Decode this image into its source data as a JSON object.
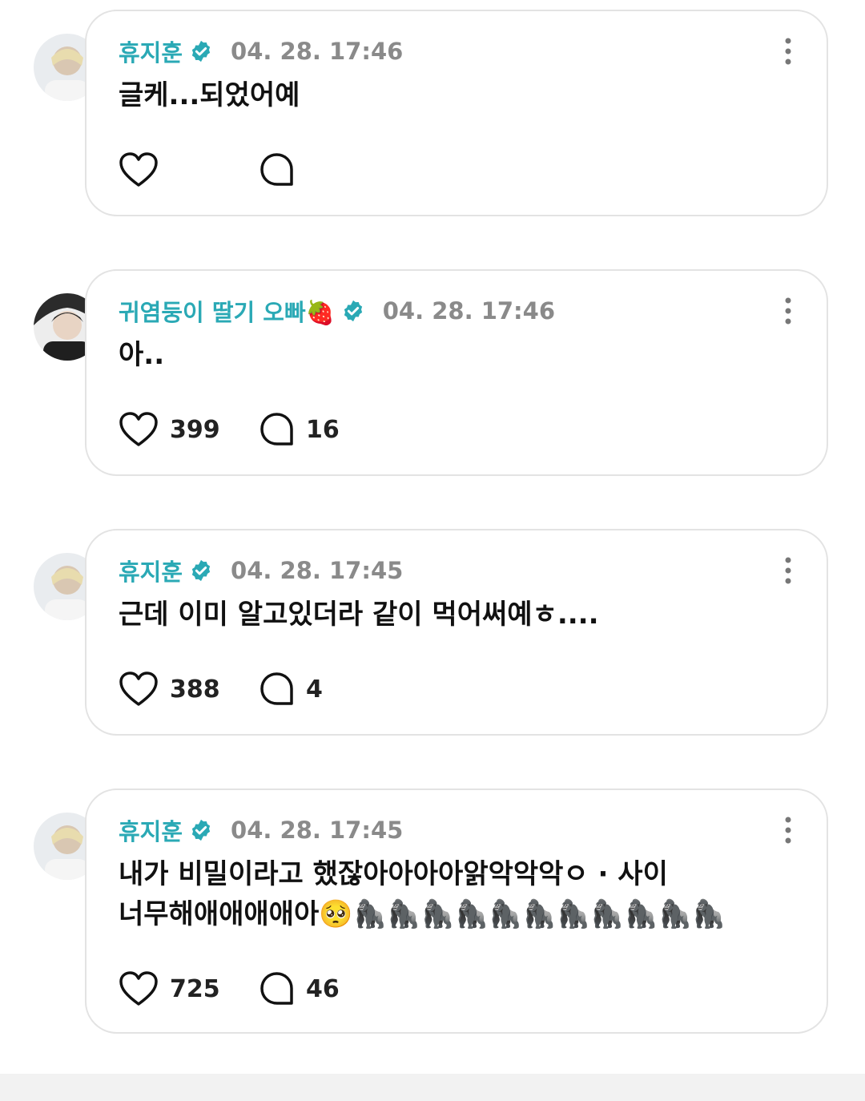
{
  "posts": [
    {
      "author": "휴지훈",
      "time": "04. 28. 17:46",
      "text": "글케...되었어예",
      "likes": "",
      "replies": ""
    },
    {
      "author": "귀염둥이 딸기 오빠🍓",
      "time": "04. 28. 17:46",
      "text": "아..",
      "likes": "399",
      "replies": "16"
    },
    {
      "author": "휴지훈",
      "time": "04. 28. 17:45",
      "text": "근데 이미 알고있더라 같이 먹어써예ㅎ....",
      "likes": "388",
      "replies": "4"
    },
    {
      "author": "휴지훈",
      "time": "04. 28. 17:45",
      "text": "내가 비밀이라고 했잖아아아아앍악악악ㅇ · 사이\n너무해애애애애아🥺🦍🦍🦍🦍🦍🦍🦍🦍🦍🦍🦍",
      "likes": "725",
      "replies": "46"
    }
  ],
  "colors": {
    "author": "#2aa9b5",
    "verified_badge": "#2aa9b5",
    "time": "#8a8a8a",
    "card_border": "#e3e3e3"
  },
  "icons": {
    "verified": "verified-badge-icon",
    "more": "more-vertical-icon",
    "like": "heart-icon",
    "reply": "comment-bubble-icon"
  }
}
